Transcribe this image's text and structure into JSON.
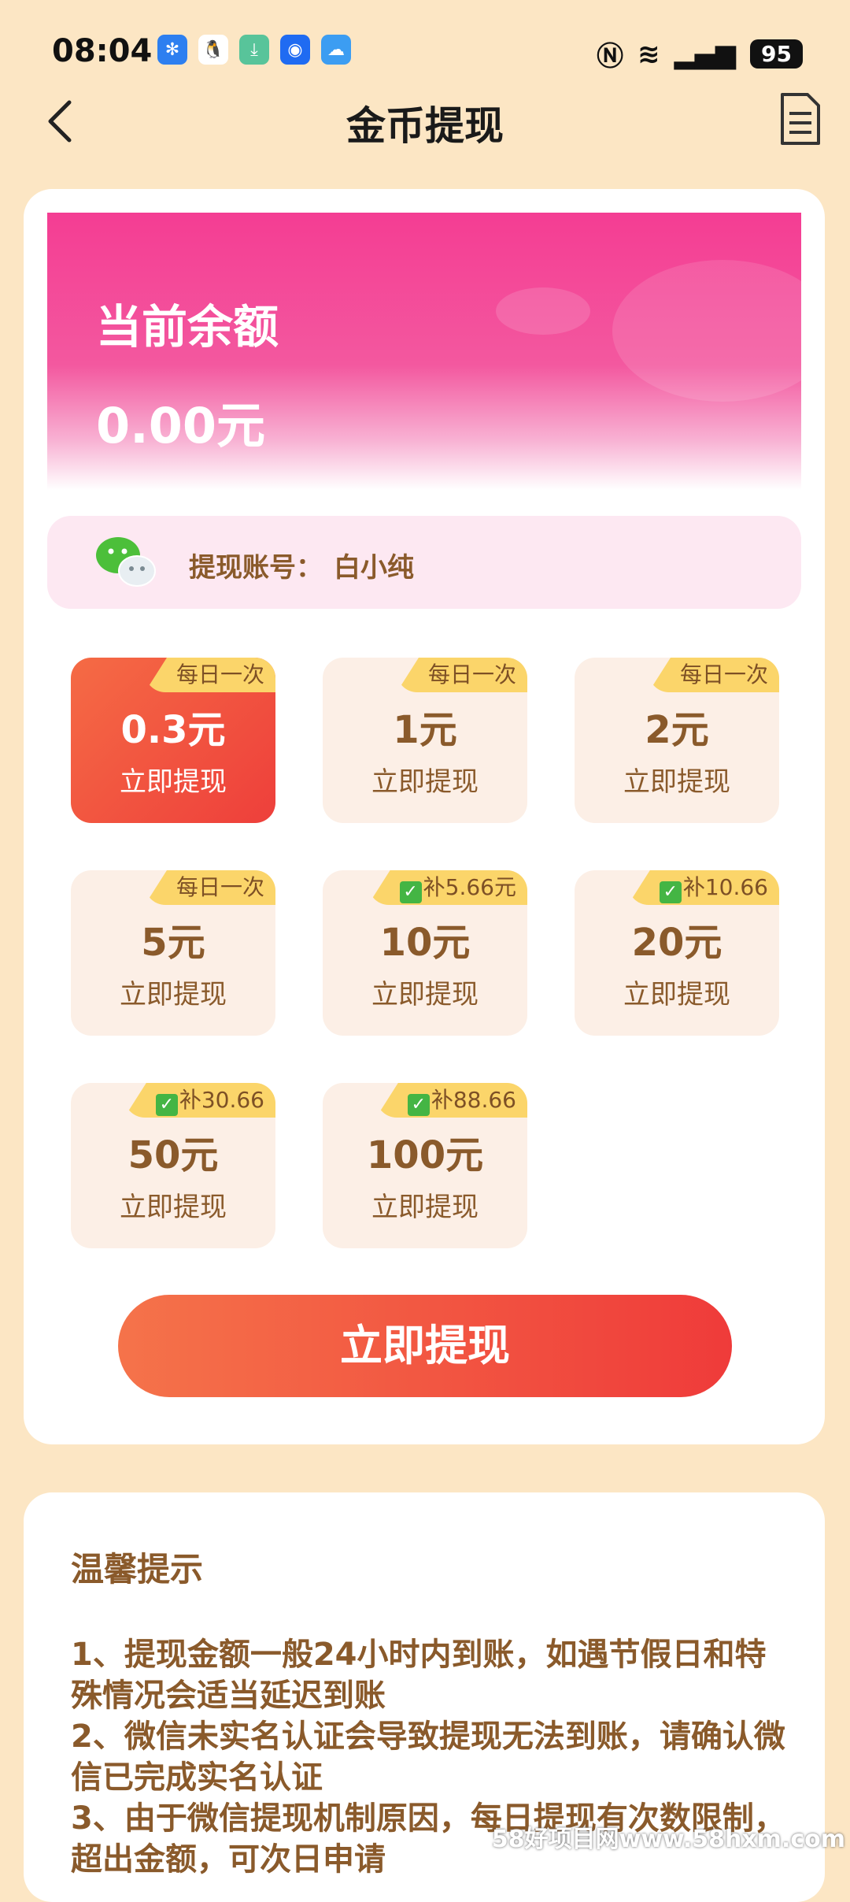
{
  "status_bar": {
    "time": "08:04",
    "battery": "95"
  },
  "header": {
    "title": "金币提现"
  },
  "balance": {
    "label": "当前余额",
    "value": "0.00元"
  },
  "account": {
    "label": "提现账号：",
    "name": "白小纯"
  },
  "tiles": [
    {
      "badge": "每日一次",
      "checked": false,
      "amount": "0.3元",
      "action": "立即提现",
      "selected": true
    },
    {
      "badge": "每日一次",
      "checked": false,
      "amount": "1元",
      "action": "立即提现",
      "selected": false
    },
    {
      "badge": "每日一次",
      "checked": false,
      "amount": "2元",
      "action": "立即提现",
      "selected": false
    },
    {
      "badge": "每日一次",
      "checked": false,
      "amount": "5元",
      "action": "立即提现",
      "selected": false
    },
    {
      "badge": "补5.66元",
      "checked": true,
      "amount": "10元",
      "action": "立即提现",
      "selected": false
    },
    {
      "badge": "补10.66",
      "checked": true,
      "amount": "20元",
      "action": "立即提现",
      "selected": false
    },
    {
      "badge": "补30.66",
      "checked": true,
      "amount": "50元",
      "action": "立即提现",
      "selected": false
    },
    {
      "badge": "补88.66",
      "checked": true,
      "amount": "100元",
      "action": "立即提现",
      "selected": false
    }
  ],
  "primary_button": {
    "label": "立即提现"
  },
  "tips": {
    "title": "温馨提示",
    "lines": [
      "1、提现金额一般24小时内到账，如遇节假日和特殊情况会适当延迟到账",
      "2、微信未实名认证会导致提现无法到账，请确认微信已完成实名认证",
      "3、由于微信提现机制原因，每日提现有次数限制，超出金额，可次日申请"
    ]
  },
  "watermark": "58好项目网www.58hxm.com",
  "colors": {
    "background": "#fce6c4",
    "brand_pink": "#f43d93",
    "text_brown": "#8a5a2b",
    "button_red": "#ef3b3a",
    "badge_yellow": "#fbd56a"
  }
}
